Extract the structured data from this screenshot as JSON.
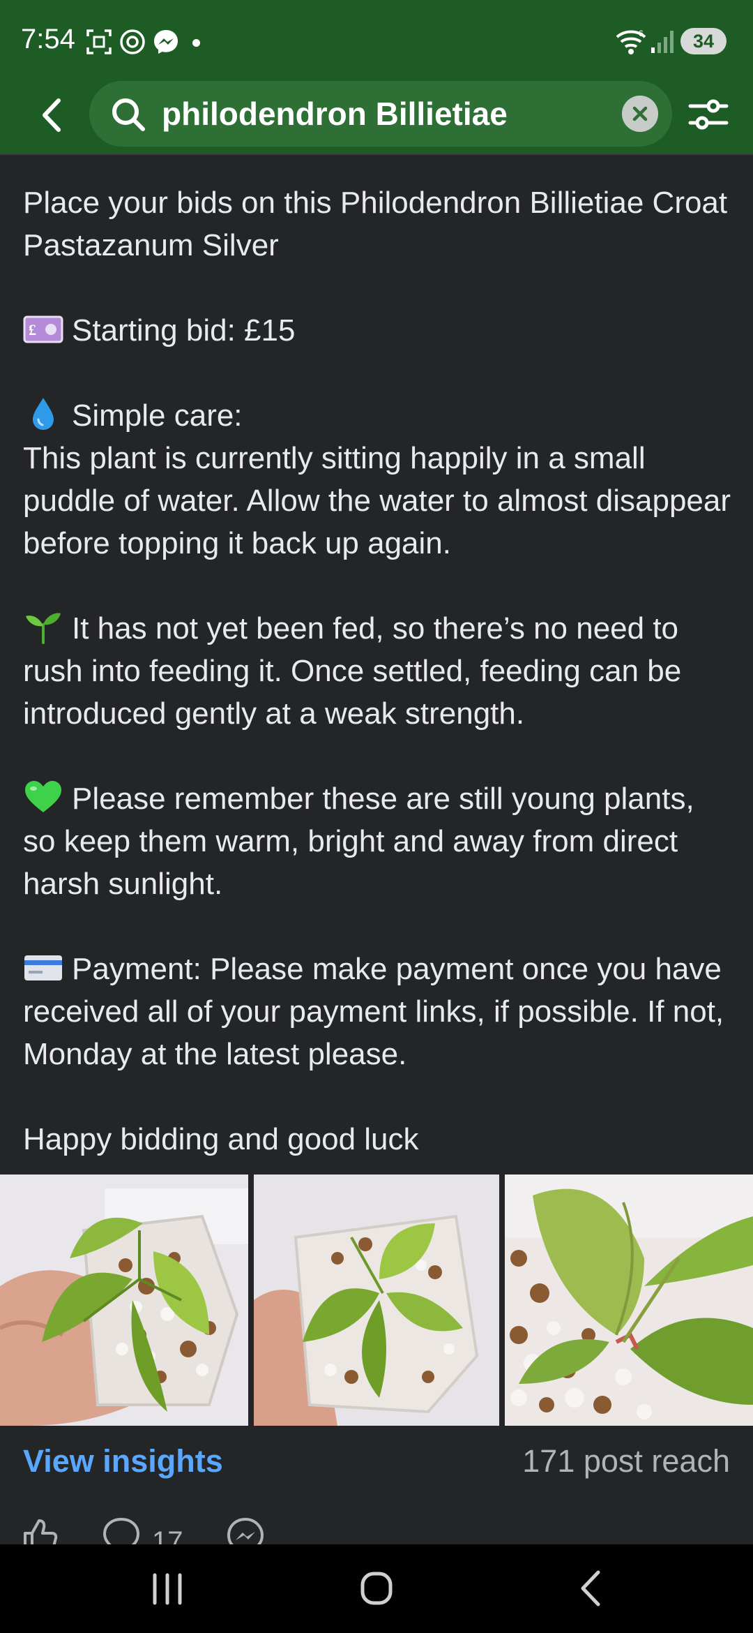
{
  "status_bar": {
    "time": "7:54",
    "battery": "34",
    "icons": [
      "screenshot-icon",
      "threads-icon",
      "messenger-icon",
      "notification-dot",
      "wifi-icon",
      "signal-icon"
    ]
  },
  "search": {
    "query": "philodendron Billietiae",
    "icons": [
      "back-arrow-icon",
      "search-icon",
      "clear-icon",
      "filter-sliders-icon"
    ]
  },
  "post": {
    "title": "Place your bids on this Philodendron Billietiae Croat Pastazanum Silver",
    "starting_bid": "Starting bid: £15",
    "care_heading": "Simple care:",
    "care_text": "This plant is currently sitting happily in a small puddle of water. Allow the water to almost disappear before topping it back up again.",
    "feeding_text": "It has not yet been fed, so there’s no need to rush into feeding it. Once settled, feeding can be introduced gently at a weak strength.",
    "young_plants_text": "Please remember these are still young plants, so keep them warm, bright and away from direct harsh sunlight.",
    "payment_text": "Payment: Please make payment once you have received all of your payment links, if possible. If not, Monday at the latest please.",
    "closing": "Happy bidding and good luck",
    "emoji_icons": [
      "pound-banknote-icon",
      "water-droplet-icon",
      "seedling-icon",
      "green-heart-icon",
      "credit-card-icon"
    ]
  },
  "photos": [
    {
      "name": "plant-photo-1"
    },
    {
      "name": "plant-photo-2"
    },
    {
      "name": "plant-photo-3"
    }
  ],
  "insights": {
    "link_label": "View insights",
    "reach": "171 post reach"
  },
  "actions": {
    "comment_count": "17",
    "icons": [
      "like-icon",
      "comment-icon",
      "messenger-share-icon"
    ]
  },
  "colors": {
    "header_green": "#1d5c24",
    "search_pill": "#2e6f36",
    "background": "#242526",
    "link_blue": "#5aa7ff"
  }
}
